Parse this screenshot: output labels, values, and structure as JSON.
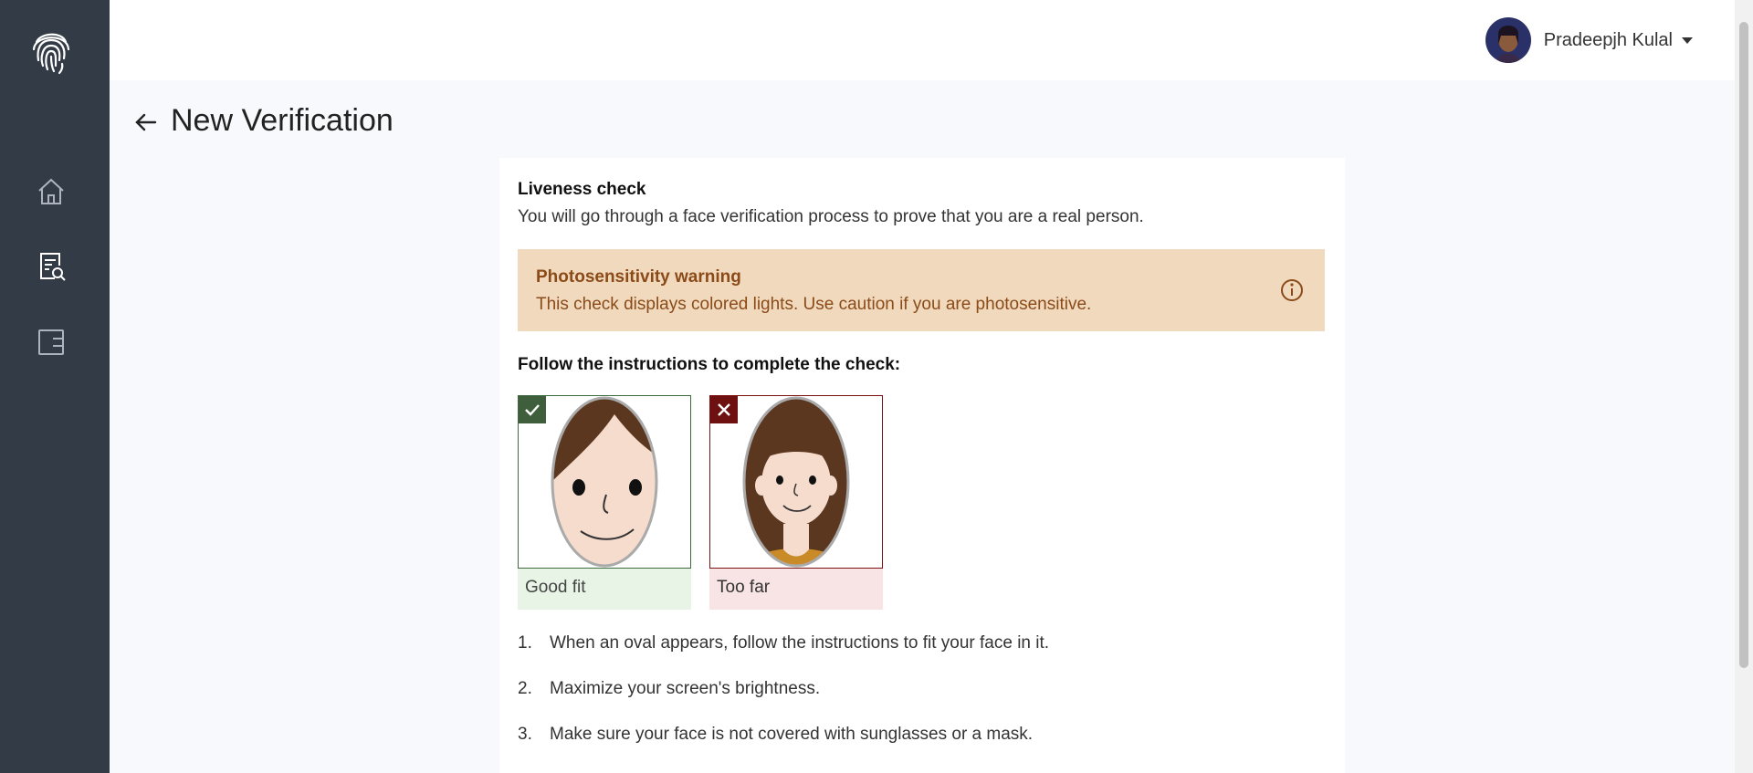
{
  "sidebar": {
    "logo": "fingerprint-icon",
    "items": [
      {
        "icon": "home-icon"
      },
      {
        "icon": "document-search-icon"
      },
      {
        "icon": "wallet-icon"
      }
    ]
  },
  "header": {
    "user_name": "Pradeepjh Kulal"
  },
  "page": {
    "title": "New Verification"
  },
  "liveness": {
    "title": "Liveness check",
    "description": "You will go through a face verification process to prove that you are a real person."
  },
  "warning": {
    "title": "Photosensitivity warning",
    "text": "This check displays colored lights. Use caution if you are photosensitive."
  },
  "instructions": {
    "title": "Follow the instructions to complete the check:",
    "examples": [
      {
        "label": "Good fit",
        "status": "good"
      },
      {
        "label": "Too far",
        "status": "bad"
      }
    ],
    "steps": [
      {
        "num": "1.",
        "text": "When an oval appears, follow the instructions to fit your face in it."
      },
      {
        "num": "2.",
        "text": "Maximize your screen's brightness."
      },
      {
        "num": "3.",
        "text": "Make sure your face is not covered with sunglasses or a mask."
      }
    ]
  },
  "colors": {
    "sidebar_bg": "#333b47",
    "warning_bg": "#f1d9be",
    "warning_text": "#8a4b18",
    "good": "#3f5f3c",
    "bad": "#6e1010"
  }
}
